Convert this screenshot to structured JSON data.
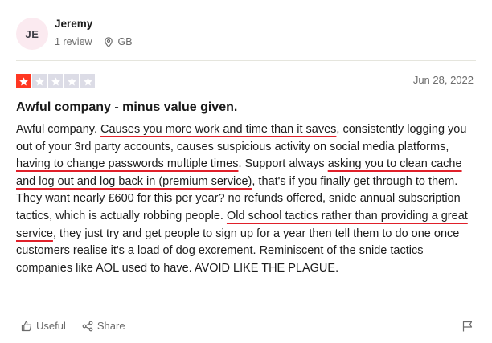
{
  "reviewer": {
    "initials": "JE",
    "name": "Jeremy",
    "review_count": "1 review",
    "country": "GB"
  },
  "review": {
    "rating": 1,
    "max_rating": 5,
    "date": "Jun 28, 2022",
    "title": "Awful company - minus value given.",
    "body": [
      {
        "t": "Awful company. ",
        "u": false
      },
      {
        "t": "Causes you more work and time than it saves",
        "u": true
      },
      {
        "t": ", consistently logging you out of your 3rd party accounts, causes suspicious activity on social media platforms, ",
        "u": false
      },
      {
        "t": "having to change passwords multiple times",
        "u": true
      },
      {
        "t": ". Support always ",
        "u": false
      },
      {
        "t": "asking you to clean cache and log out and log back in (premium service)",
        "u": true
      },
      {
        "t": ", that's if you finally get through to them. They want nearly £600 for this per year? no refunds offered, snide annual subscription tactics, which is actually robbing people. ",
        "u": false
      },
      {
        "t": "Old school tactics rather than providing a great service",
        "u": true
      },
      {
        "t": ", they just try and get people to sign up for a year then tell them to do one once customers realise it's a load of dog excrement. Reminiscent of the snide tactics companies like AOL used to have. AVOID LIKE THE PLAGUE.",
        "u": false
      }
    ]
  },
  "actions": {
    "useful_label": "Useful",
    "share_label": "Share"
  },
  "colors": {
    "star_active": "#ff3722",
    "star_inactive": "#dcdce6",
    "underline": "#e0202a"
  },
  "icons": [
    "location-pin-icon",
    "thumbs-up-icon",
    "share-icon",
    "flag-icon",
    "star-icon"
  ]
}
